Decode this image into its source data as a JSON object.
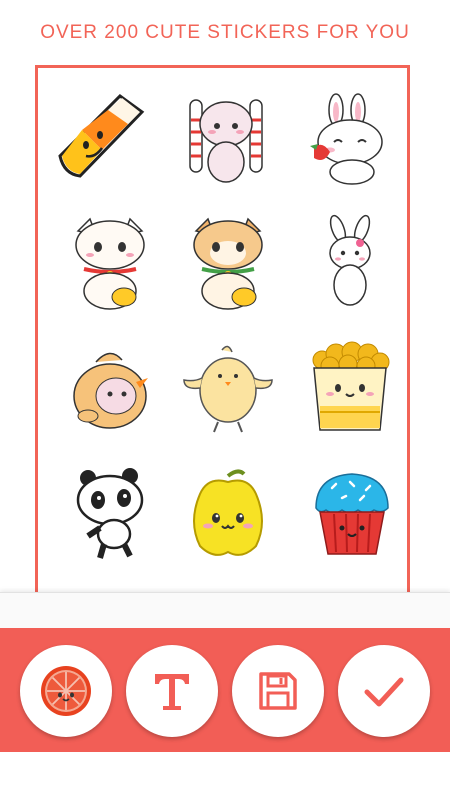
{
  "header": {
    "title": "OVER 200 CUTE STICKERS FOR YOU"
  },
  "colors": {
    "accent": "#f26457",
    "toolbar": "#f25e56",
    "background": "#ffffff"
  },
  "stickers": [
    {
      "name": "candy-corn-sticker"
    },
    {
      "name": "striped-bunny-sticker"
    },
    {
      "name": "bunny-with-strawberry-sticker"
    },
    {
      "name": "lucky-cat-white-sticker"
    },
    {
      "name": "lucky-cat-orange-sticker"
    },
    {
      "name": "waving-bunny-sticker"
    },
    {
      "name": "chick-costume-sticker"
    },
    {
      "name": "yellow-chick-sticker"
    },
    {
      "name": "popcorn-sticker"
    },
    {
      "name": "panda-sticker"
    },
    {
      "name": "bell-pepper-sticker"
    },
    {
      "name": "cupcake-sticker"
    }
  ],
  "toolbar": {
    "buttons": [
      {
        "name": "sticker-button",
        "icon": "grapefruit-icon"
      },
      {
        "name": "text-button",
        "icon": "text-t-icon"
      },
      {
        "name": "save-button",
        "icon": "floppy-disk-icon"
      },
      {
        "name": "done-button",
        "icon": "checkmark-icon"
      }
    ]
  }
}
